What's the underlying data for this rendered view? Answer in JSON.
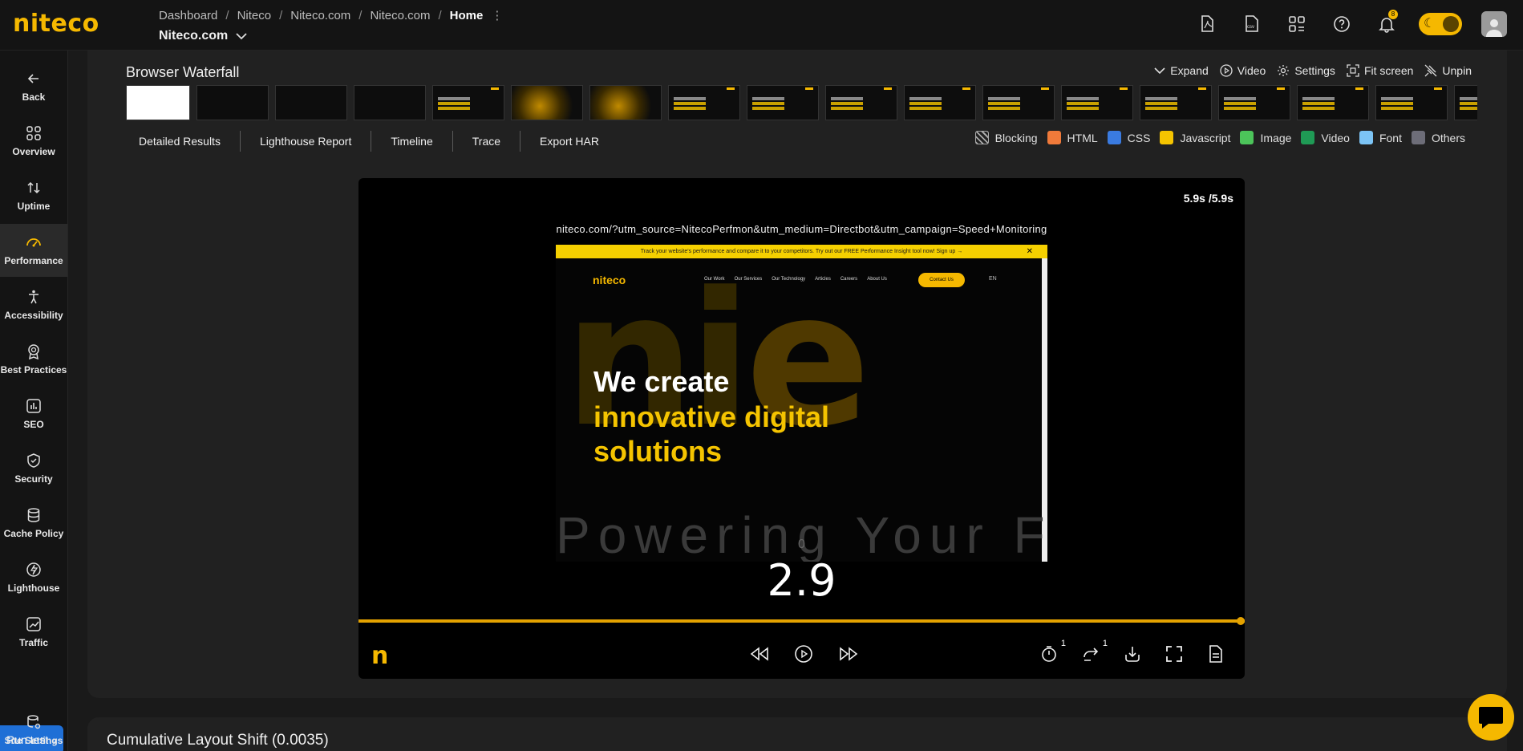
{
  "brand": {
    "logo": "niteco",
    "accent": "#f5b800"
  },
  "breadcrumb": [
    "Dashboard",
    "Niteco",
    "Niteco.com",
    "Niteco.com",
    "Home"
  ],
  "site_selector": "Niteco.com",
  "notifications_count": "8",
  "sidebar": {
    "items": [
      {
        "label": "Back",
        "icon": "arrow-left-icon"
      },
      {
        "label": "Overview",
        "icon": "grid-icon"
      },
      {
        "label": "Uptime",
        "icon": "arrows-updown-icon"
      },
      {
        "label": "Performance",
        "icon": "gauge-icon",
        "active": true
      },
      {
        "label": "Accessibility",
        "icon": "person-icon"
      },
      {
        "label": "Best Practices",
        "icon": "award-icon"
      },
      {
        "label": "SEO",
        "icon": "bar-chart-icon"
      },
      {
        "label": "Security",
        "icon": "shield-icon"
      },
      {
        "label": "Cache Policy",
        "icon": "database-icon"
      },
      {
        "label": "Lighthouse",
        "icon": "lighthouse-icon"
      },
      {
        "label": "Traffic",
        "icon": "traffic-icon"
      },
      {
        "label": "Site Settings",
        "icon": "settings-db-icon"
      }
    ],
    "run_test": "Run test"
  },
  "waterfall": {
    "title": "Browser Waterfall",
    "actions": [
      "Expand",
      "Video",
      "Settings",
      "Fit screen",
      "Unpin"
    ],
    "tabs": [
      "Detailed Results",
      "Lighthouse Report",
      "Timeline",
      "Trace",
      "Export HAR"
    ],
    "legend": [
      {
        "label": "Blocking",
        "color": "pattern"
      },
      {
        "label": "HTML",
        "color": "#f07a3a"
      },
      {
        "label": "CSS",
        "color": "#3a7be0"
      },
      {
        "label": "Javascript",
        "color": "#f5c400"
      },
      {
        "label": "Image",
        "color": "#4cc45a"
      },
      {
        "label": "Video",
        "color": "#1f9a55"
      },
      {
        "label": "Font",
        "color": "#7cc4f5"
      },
      {
        "label": "Others",
        "color": "#6d6d78"
      }
    ]
  },
  "player": {
    "time": "5.9s /5.9s",
    "url": "niteco.com/?utm_source=NitecoPerfmon&utm_medium=Directbot&utm_campaign=Speed+Monitoring",
    "counter_small": "0",
    "counter": "2.9",
    "progress": 1.0,
    "rate_badge": "1",
    "repeat_badge": "1",
    "site": {
      "banner": "Track your website's performance and compare it to your competitors. Try out our FREE Performance Insight tool now!  Sign up →",
      "logo": "niteco",
      "nav": [
        "Our Work",
        "Our Services",
        "Our Technology",
        "Articles",
        "Careers",
        "About Us"
      ],
      "contact": "Contact Us",
      "lang": "EN",
      "headline1": "We create",
      "headline2a": "innovative digital",
      "headline2b": "solutions",
      "tagline": "Powering Your F"
    }
  },
  "cls": {
    "title": "Cumulative Layout Shift (0.0035)"
  }
}
